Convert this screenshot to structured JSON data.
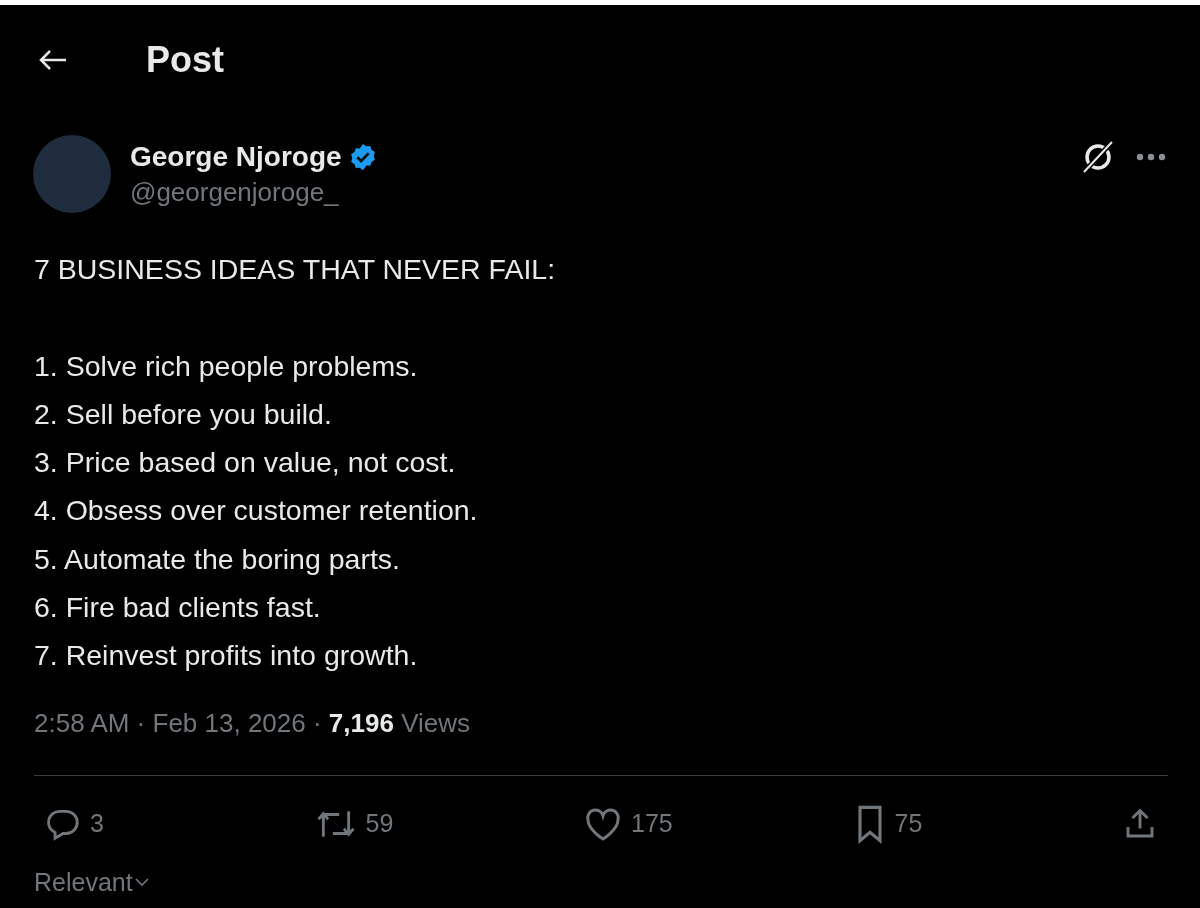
{
  "header": {
    "title": "Post"
  },
  "author": {
    "name": "George Njoroge",
    "verified": true,
    "handle": "@georgenjoroge_"
  },
  "post": {
    "heading": "7 BUSINESS IDEAS THAT NEVER FAIL:",
    "lines": [
      "1. Solve rich people problems.",
      "2. Sell before you build.",
      "3. Price based on value, not cost.",
      "4. Obsess over customer retention.",
      "5. Automate the boring parts.",
      "6. Fire bad clients fast.",
      "7. Reinvest profits into growth."
    ],
    "meta": "2:58 AM · Feb 13, 2026 · **7,196** Views"
  },
  "actions": [
    {
      "kind": "reply",
      "count": "3"
    },
    {
      "kind": "repost",
      "count": "59"
    },
    {
      "kind": "like",
      "count": "175"
    },
    {
      "kind": "bookmark",
      "count": "75"
    },
    {
      "kind": "share"
    }
  ],
  "sort": {
    "label": "Relevant"
  }
}
